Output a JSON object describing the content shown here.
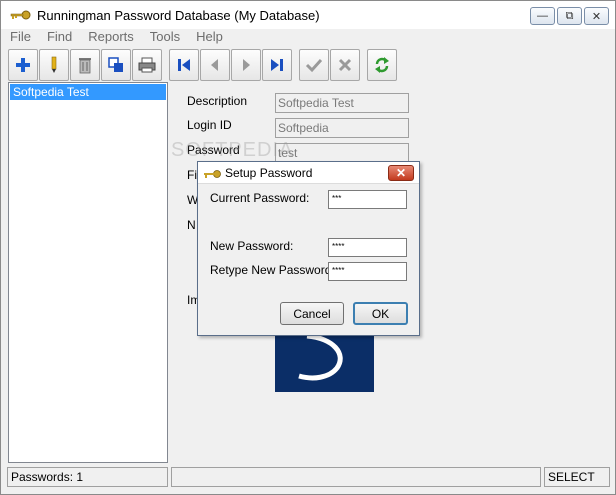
{
  "window": {
    "title": "Runningman Password Database (My Database)"
  },
  "menu": [
    "File",
    "Find",
    "Reports",
    "Tools",
    "Help"
  ],
  "toolbar": {
    "buttons": [
      "add-icon",
      "edit-pencil-icon",
      "delete-trash-icon",
      "copy-icon",
      "print-icon",
      "first-record-icon",
      "previous-record-icon",
      "next-record-icon",
      "last-record-icon",
      "save-check-icon",
      "cancel-x-icon",
      "refresh-icon"
    ]
  },
  "list": {
    "items": [
      "Softpedia Test"
    ]
  },
  "details": {
    "description_label": "Description",
    "description_value": "Softpedia Test",
    "login_label": "Login ID",
    "login_value": "Softpedia",
    "password_label": "Password",
    "password_value": "test",
    "file_label_partial": "Fil",
    "web_label_partial": "W",
    "notes_label_partial": "N",
    "image_label_partial": "Im"
  },
  "watermark": "SOFTPEDIA",
  "dialog": {
    "title": "Setup Password",
    "current_label": "Current Password:",
    "current_value": "***",
    "new_label": "New Password:",
    "new_value": "****",
    "retype_label": "Retype New Password:",
    "retype_value": "****",
    "cancel_label": "Cancel",
    "ok_label": "OK"
  },
  "status": {
    "count": "Passwords: 1",
    "middle": "",
    "mode": "SELECT"
  },
  "colors": {
    "selection": "#3399ff",
    "logo_bg": "#0b2e67",
    "add_icon": "#1c5fd0",
    "nav_icon": "#1a4fc0",
    "refresh_icon": "#2f9a2f"
  }
}
